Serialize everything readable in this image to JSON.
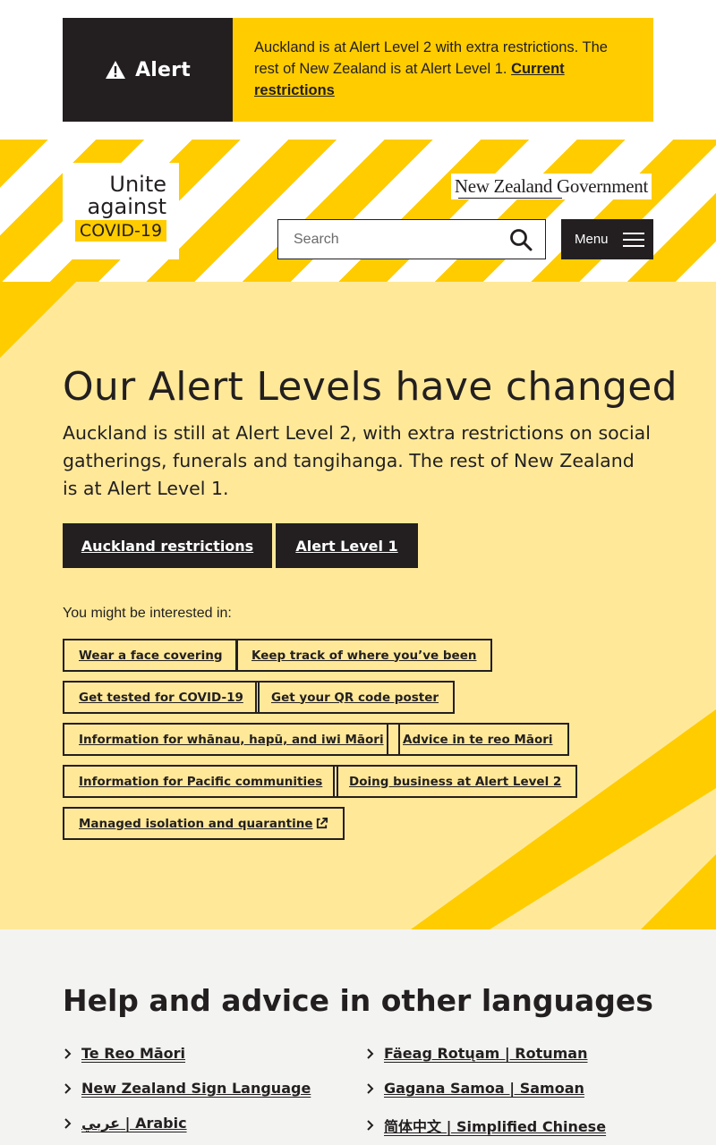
{
  "alert": {
    "title": "Alert",
    "message": "Auckland is at Alert Level 2 with extra restrictions. The rest of New Zealand is at Alert Level 1. ",
    "link": "Current restrictions"
  },
  "header": {
    "logo_line1": "Unite",
    "logo_line2": "against",
    "logo_line3": "COVID-19",
    "gov_name": "New Zealand Government",
    "search_placeholder": "Search",
    "menu_label": "Menu"
  },
  "hero": {
    "title": "Our Alert Levels have changed",
    "subtitle": "Auckland is still at Alert Level 2, with extra restrictions on social gatherings, funerals and tangihanga. The rest of New Zealand is at Alert Level 1.",
    "buttons": [
      "Auckland restrictions",
      "Alert Level 1"
    ],
    "interest_label": "You might be interested in:",
    "links": [
      "Wear a face covering",
      "Keep track of where you’ve been",
      "Get tested for COVID-19",
      "Get your QR code poster",
      "Information for whānau, hapū, and iwi Māori",
      "Advice in te reo Māori",
      "Information for Pacific communities",
      "Doing business at Alert Level 2",
      "Managed isolation and quarantine"
    ]
  },
  "languages": {
    "title": "Help and advice in other languages",
    "items": [
      "Te Reo Māori",
      "Fäeag Rotųam | Rotuman",
      "New Zealand Sign Language",
      "Gagana Samoa | Samoan",
      "عربي | Arabic",
      "简体中文 | Simplified Chinese"
    ]
  },
  "colors": {
    "accent": "#ffcc00",
    "dark": "#231f20",
    "hero_bg": "#ffe999",
    "lang_bg": "#f3f3f1"
  },
  "icons": {
    "alert": "warning-triangle-icon",
    "search": "search-icon",
    "menu": "hamburger-icon",
    "external": "external-link-icon",
    "chevron": "chevron-right-icon"
  }
}
